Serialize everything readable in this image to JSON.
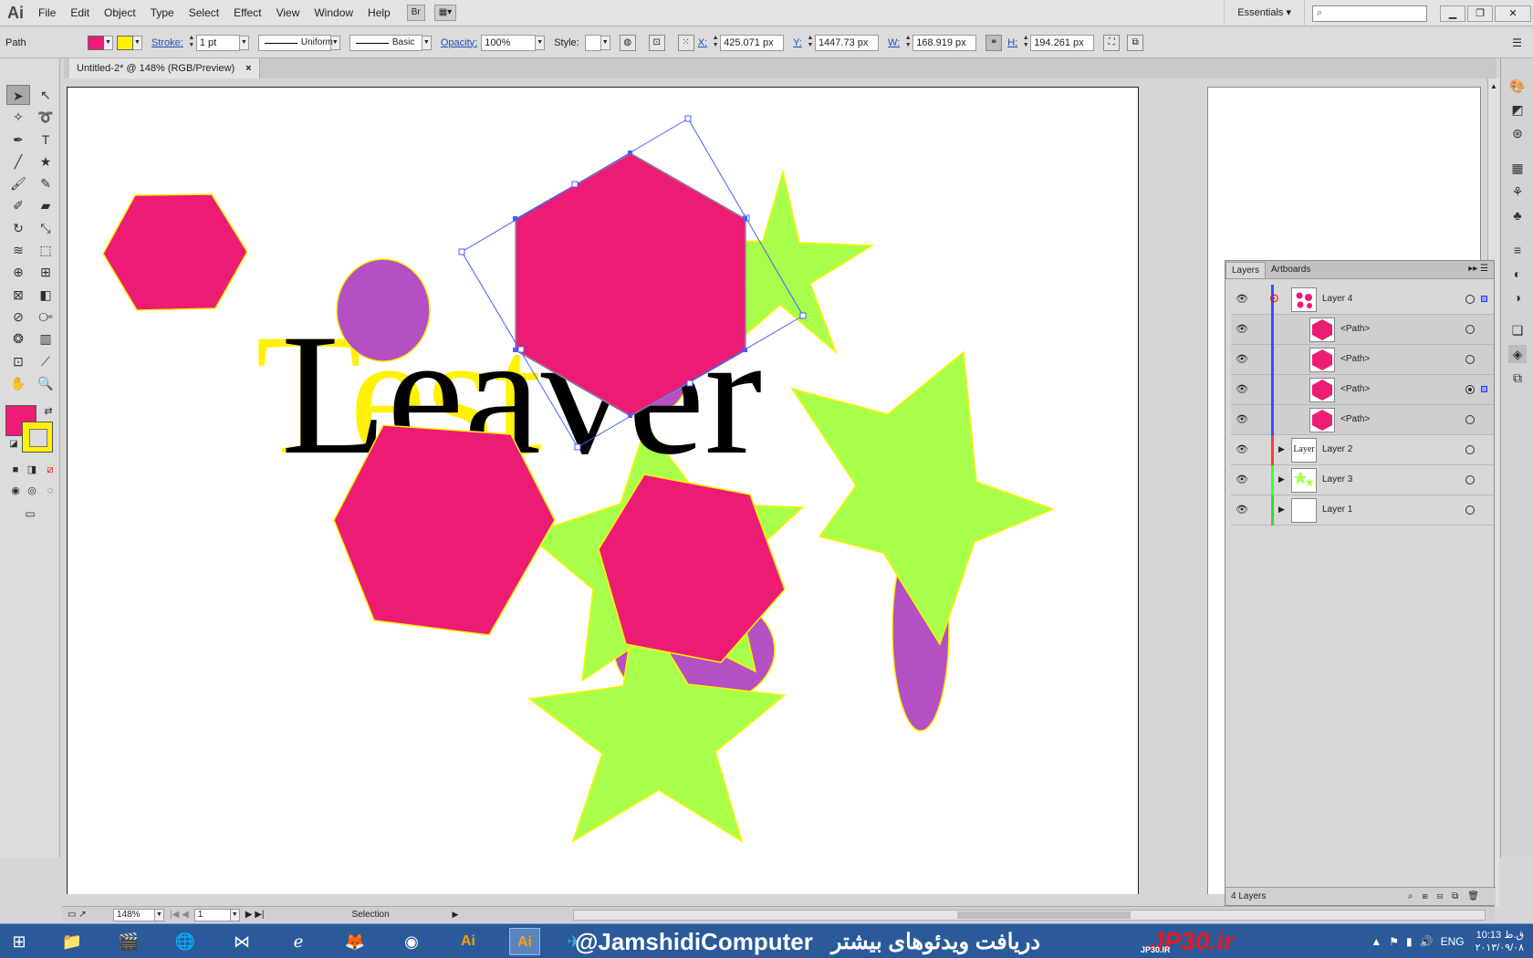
{
  "app": {
    "logo": "Ai",
    "bridge": "Br",
    "workspace": "Essentials",
    "min": "▁",
    "max": "❐",
    "close": "✕"
  },
  "menu": [
    "File",
    "Edit",
    "Object",
    "Type",
    "Select",
    "Effect",
    "View",
    "Window",
    "Help"
  ],
  "control": {
    "selection_type": "Path",
    "stroke_label": "Stroke:",
    "stroke_weight": "1 pt",
    "profile": "Uniform",
    "brush": "Basic",
    "opacity_label": "Opacity:",
    "opacity": "100%",
    "style_label": "Style:",
    "x_label": "X:",
    "x": "425.071 px",
    "y_label": "Y:",
    "y": "1447.73 px",
    "w_label": "W:",
    "w": "168.919 px",
    "h_label": "H:",
    "h": "194.261 px"
  },
  "document": {
    "tab_title": "Untitled-2* @ 148% (RGB/Preview)",
    "close": "×"
  },
  "colors": {
    "fill": "#ec1c74",
    "stroke": "#fff200",
    "pink": "#ec1c74",
    "lime": "#a8ff4b",
    "purple": "#b44fc4",
    "yellow": "#fff200",
    "selection": "#4a5cff"
  },
  "artwork": {
    "black_text": "Leaver",
    "yellow_text": "Test"
  },
  "layers": {
    "tabs": [
      "Layers",
      "Artboards"
    ],
    "rows": [
      {
        "name": "Layer 4",
        "color": "#3b4dff"
      },
      {
        "name": "<Path>",
        "color": "#3b4dff"
      },
      {
        "name": "<Path>",
        "color": "#3b4dff"
      },
      {
        "name": "<Path>",
        "color": "#3b4dff"
      },
      {
        "name": "<Path>",
        "color": "#3b4dff"
      },
      {
        "name": "Layer 2",
        "color": "#ff3b3b"
      },
      {
        "name": "Layer 3",
        "color": "#3bff3b"
      },
      {
        "name": "Layer 1",
        "color": "#3bd43b"
      }
    ],
    "thumb_text": "Layer",
    "count": "4 Layers"
  },
  "status": {
    "zoom": "148%",
    "artboard": "1",
    "tool": "Selection"
  },
  "taskbar": {
    "handle": "@JamshidiComputer",
    "farsi": "دریافت ویدئوهای بیشتر",
    "site": "JP30.ir",
    "logo_text": "JP30.IR",
    "lang": "ENG",
    "time": "10:13 ق.ظ",
    "date": "۲۰۱۳/۰۹/۰۸"
  }
}
